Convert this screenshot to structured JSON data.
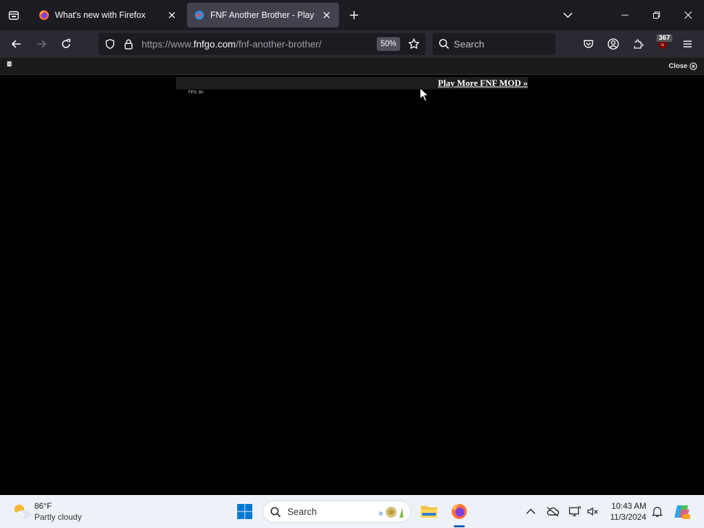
{
  "browser": {
    "tabs": [
      {
        "title": "What's new with Firefox",
        "active": false
      },
      {
        "title": "FNF Another Brother - Play Onl",
        "active": true
      }
    ],
    "url": {
      "prefix": "https://www.",
      "host": "fnfgo.com",
      "path": "/fnf-another-brother/"
    },
    "zoom": "50%",
    "search_placeholder": "Search",
    "ublock_count": "367"
  },
  "notification_bar": {
    "close_label": "Close"
  },
  "page": {
    "play_more_label": "Play More FNF MOD »",
    "fps_text": "FPS: 60"
  },
  "taskbar": {
    "weather": {
      "temp": "86°F",
      "desc": "Partly cloudy"
    },
    "search_placeholder": "Search",
    "time": "10:43 AM",
    "date": "11/3/2024"
  },
  "colors": {
    "tabstrip": "#1c1b22",
    "toolbar": "#2b2a33",
    "active_tab": "#42414d",
    "taskbar": "#eef1f7"
  }
}
